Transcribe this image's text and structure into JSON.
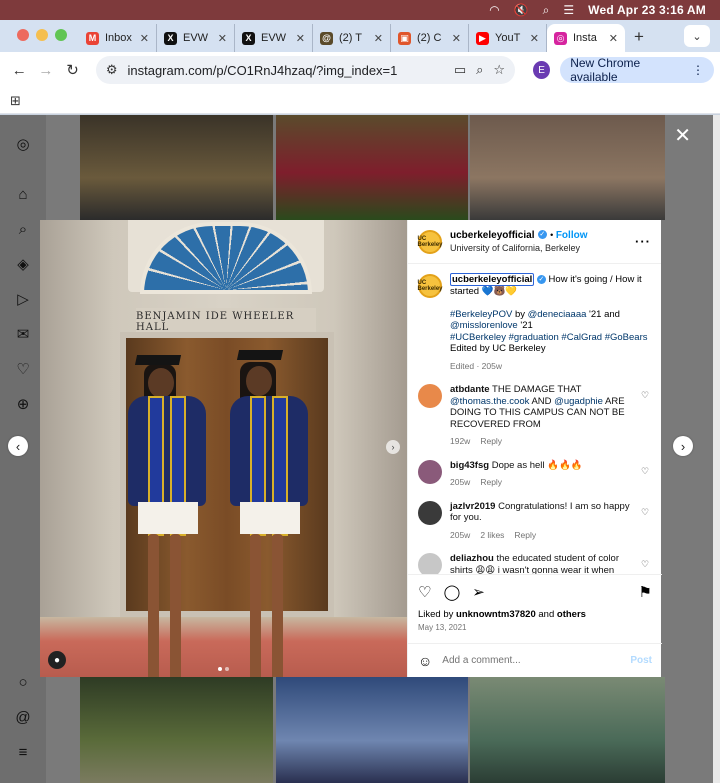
{
  "menubar": {
    "clock": "Wed Apr 23  3:16 AM",
    "icons": [
      "wifi-icon",
      "mute-icon",
      "search-icon",
      "control-center-icon"
    ]
  },
  "tabs": [
    {
      "label": "Inbox",
      "favicon": "gmail-icon",
      "color": "#ea4335",
      "glyph": "M"
    },
    {
      "label": "EVW",
      "favicon": "x-icon",
      "color": "#111111",
      "glyph": "X"
    },
    {
      "label": "EVW",
      "favicon": "x-icon",
      "color": "#111111",
      "glyph": "X"
    },
    {
      "label": "(2) T",
      "favicon": "threads-icon",
      "color": "#5a4a2a",
      "glyph": "@"
    },
    {
      "label": "(2) C",
      "favicon": "bookmark-app-icon",
      "color": "#e0562b",
      "glyph": "▣"
    },
    {
      "label": "YouT",
      "favicon": "youtube-icon",
      "color": "#ff0000",
      "glyph": "▶"
    },
    {
      "label": "Insta",
      "favicon": "instagram-icon",
      "color": "#d6249f",
      "glyph": "◎",
      "active": true
    }
  ],
  "toolbar": {
    "url": "instagram.com/p/CO1RnJ4hzaq/?img_index=1",
    "profile_initial": "E",
    "new_chrome": "New Chrome available"
  },
  "post": {
    "username": "ucberkeleyofficial",
    "follow": "Follow",
    "location": "University of California, Berkeley",
    "logo_text": "UC Berkeley",
    "photo_sign": "BENJAMIN IDE WHEELER HALL",
    "caption_text": " How it's going / How it started 💙🐻💛",
    "caption_line2_prefix": "#BerkeleyPOV",
    "caption_line2_by": " by ",
    "caption_mention1": "@deneciaaaa",
    "caption_line2_suffix": " '21 and",
    "caption_mention2": "@misslorenlove",
    "caption_line3_suffix": " '21",
    "caption_tags": "#UCBerkeley #graduation #CalGrad #GoBears",
    "caption_edited": "Edited by UC Berkeley",
    "caption_meta": "Edited · 205w",
    "likes_prefix": "Liked by ",
    "likes_user": "unknowntm37820",
    "likes_and": " and ",
    "likes_others": "others",
    "date": "May 13, 2021",
    "add_comment_placeholder": "Add a comment...",
    "post_button": "Post"
  },
  "comments": [
    {
      "user": "atbdante",
      "text_before": " THE DAMAGE THAT ",
      "mention1": "@thomas.the.cook",
      "text_mid": " AND ",
      "mention2": "@ugadphie",
      "text_after": " ARE DOING TO THIS CAMPUS CAN NOT BE RECOVERED FROM",
      "age": "192w",
      "likes": "",
      "reply": "Reply",
      "avatar_color": "#e8894a"
    },
    {
      "user": "big43fsg",
      "text": " Dope as hell 🔥🔥🔥",
      "age": "205w",
      "likes": "",
      "reply": "Reply",
      "avatar_color": "#8a5a7a"
    },
    {
      "user": "jazlvr2019",
      "text": " Congratulations! I am so happy for you.",
      "age": "205w",
      "likes": "2 likes",
      "reply": "Reply",
      "avatar_color": "#3a3a3a"
    },
    {
      "user": "deliazhou",
      "text": " the educated student of color shirts 😩😩 i wasn't gonna wear it when they",
      "age": "",
      "likes": "",
      "reply": "",
      "avatar_color": "#c7c7c7"
    }
  ]
}
